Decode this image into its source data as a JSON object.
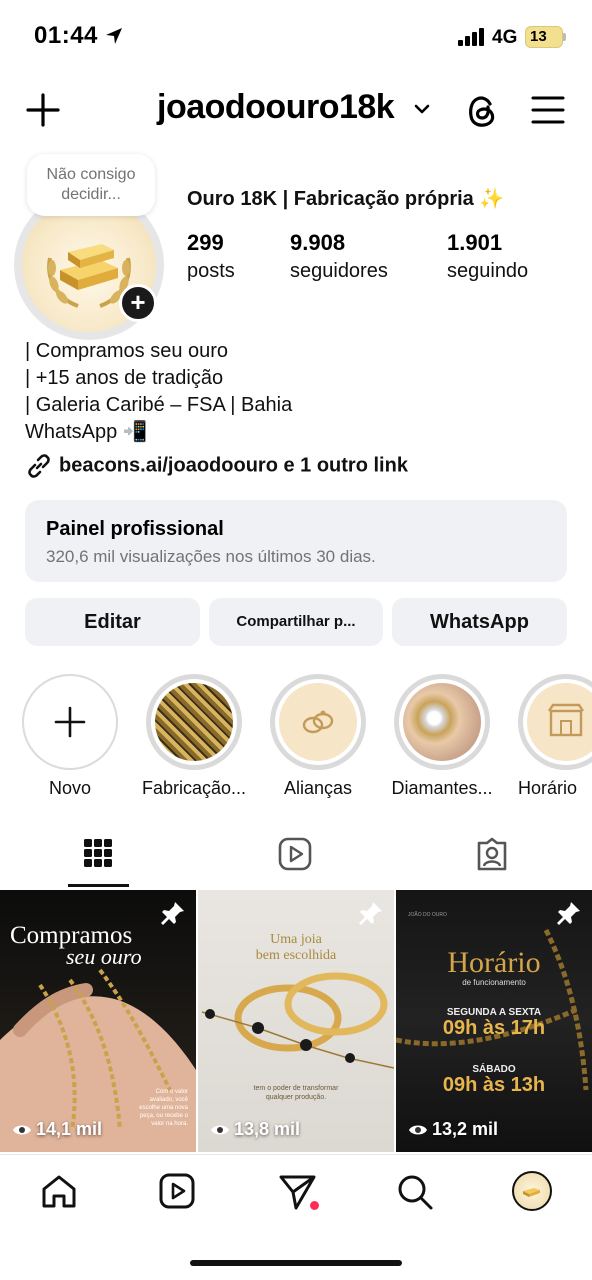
{
  "status_bar": {
    "time": "01:44",
    "network": "4G",
    "battery": "13",
    "icons": [
      "location-arrow-icon",
      "signal-bars-icon",
      "battery-icon"
    ]
  },
  "header": {
    "username": "joaodoouro18k",
    "icons": [
      "plus-icon",
      "chevron-down-icon",
      "threads-icon",
      "menu-icon"
    ]
  },
  "profile": {
    "note": "Não consigo decidir...",
    "name": "Ouro 18K | Fabricação própria ✨",
    "stats": [
      {
        "value": "299",
        "label": "posts"
      },
      {
        "value": "9.908",
        "label": "seguidores"
      },
      {
        "value": "1.901",
        "label": "seguindo"
      }
    ],
    "bio": [
      "| Compramos seu ouro",
      "| +15 anos de tradição",
      "| Galeria Caribé – FSA | Bahia",
      "WhatsApp 📲"
    ],
    "link": "beacons.ai/joaodoouro e 1 outro link"
  },
  "dashboard": {
    "title": "Painel profissional",
    "subtitle": "320,6 mil visualizações nos últimos 30 dias."
  },
  "actions": {
    "edit": "Editar",
    "share": "Compartilhar p...",
    "whatsapp": "WhatsApp"
  },
  "highlights": [
    {
      "label": "Novo"
    },
    {
      "label": "Fabricação..."
    },
    {
      "label": "Alianças"
    },
    {
      "label": "Diamantes..."
    },
    {
      "label": "Horário"
    }
  ],
  "tabs": [
    "grid-icon",
    "reels-icon",
    "tagged-icon"
  ],
  "posts": [
    {
      "views": "14,1 mil",
      "title_line1": "Compramos",
      "title_line2": "seu ouro",
      "caption": [
        "Com o valor",
        "avaliado, você",
        "escolhe uma nova",
        "peça, ou recebe o",
        "valor na hora."
      ]
    },
    {
      "views": "13,8 mil",
      "title_line1": "Uma joia",
      "title_line2": "bem escolhida",
      "caption": [
        "tem o poder de transformar",
        "qualquer produção."
      ]
    },
    {
      "views": "13,2 mil",
      "title": "Horário",
      "subtitle": "de funcionamento",
      "line1": "SEGUNDA A SEXTA",
      "hours1": "09h às 17h",
      "line2": "SÁBADO",
      "hours2": "09h às 13h",
      "brand": "JOÃO DO OURO"
    }
  ],
  "bottom_nav": [
    "home-icon",
    "reels-icon",
    "messages-icon",
    "search-icon",
    "profile-avatar"
  ],
  "colors": {
    "button_bg": "#eff1f4",
    "muted_text": "#737373",
    "notification_dot": "#ff2d55",
    "gold": "#d4a64a"
  }
}
